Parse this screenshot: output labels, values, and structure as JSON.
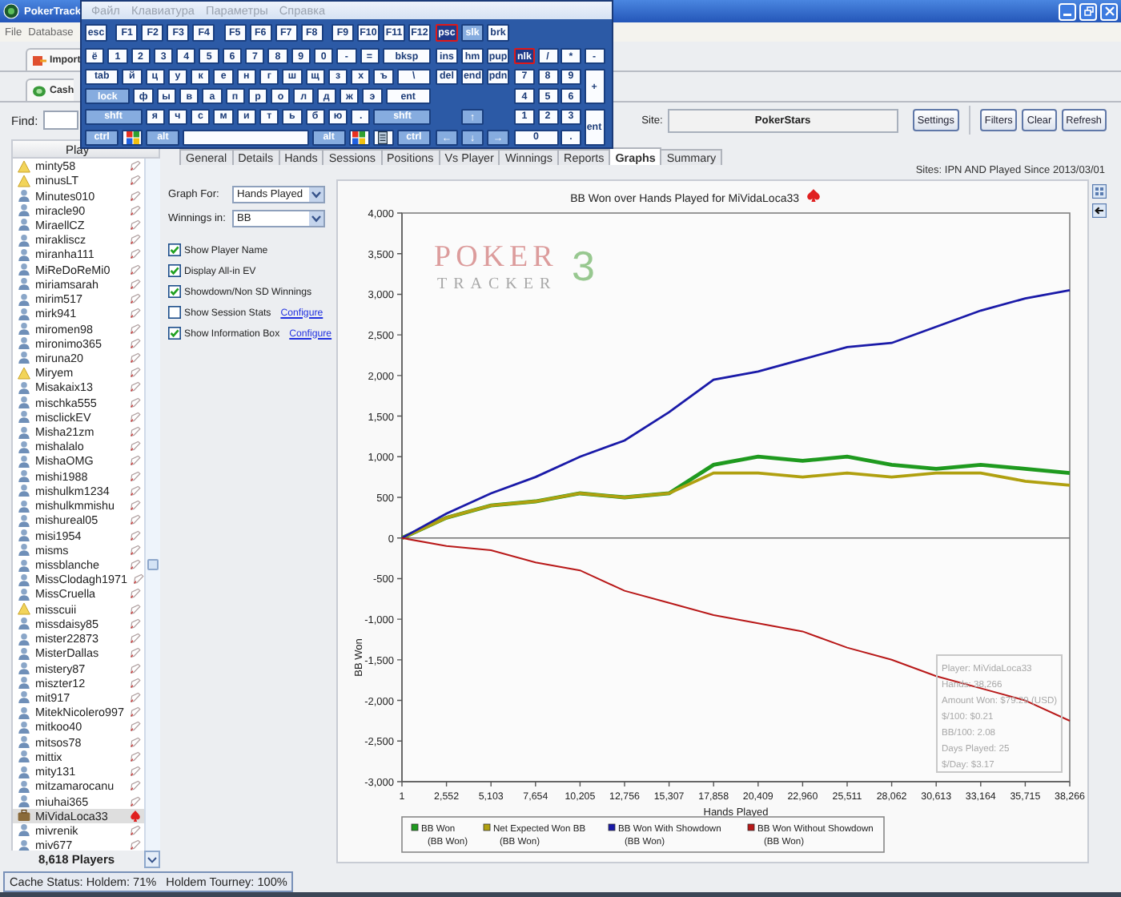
{
  "main_window": {
    "title": "PokerTrack",
    "menu": [
      "File",
      "Database"
    ],
    "toolbar_tab": "Import",
    "section_tab": "Cash",
    "find": {
      "label": "Find:"
    },
    "site": {
      "label": "Site:",
      "value": "PokerStars"
    },
    "buttons": [
      "Settings",
      "Filters",
      "Clear",
      "Refresh"
    ]
  },
  "players": {
    "header": "Play",
    "rows": [
      {
        "name": "minty58",
        "kind": "warning",
        "selected": false
      },
      {
        "name": "minusLT",
        "kind": "warning",
        "selected": false
      },
      {
        "name": "Minutes010",
        "kind": "person",
        "selected": false
      },
      {
        "name": "miracle90",
        "kind": "person",
        "selected": false
      },
      {
        "name": "MiraellCZ",
        "kind": "person",
        "selected": false
      },
      {
        "name": "mirakliscz",
        "kind": "person",
        "selected": false
      },
      {
        "name": "miranha111",
        "kind": "person",
        "selected": false
      },
      {
        "name": "MiReDoReMi0",
        "kind": "person",
        "selected": false
      },
      {
        "name": "miriamsarah",
        "kind": "person",
        "selected": false
      },
      {
        "name": "mirim517",
        "kind": "person",
        "selected": false
      },
      {
        "name": "mirk941",
        "kind": "person",
        "selected": false
      },
      {
        "name": "miromen98",
        "kind": "person",
        "selected": false
      },
      {
        "name": "mironimo365",
        "kind": "person",
        "selected": false
      },
      {
        "name": "miruna20",
        "kind": "person",
        "selected": false
      },
      {
        "name": "Miryem",
        "kind": "warning",
        "selected": false
      },
      {
        "name": "Misakaix13",
        "kind": "person",
        "selected": false
      },
      {
        "name": "mischka555",
        "kind": "person",
        "selected": false
      },
      {
        "name": "misclickEV",
        "kind": "person",
        "selected": false
      },
      {
        "name": "Misha21zm",
        "kind": "person",
        "selected": false
      },
      {
        "name": "mishalalo",
        "kind": "person",
        "selected": false
      },
      {
        "name": "MishaOMG",
        "kind": "person",
        "selected": false
      },
      {
        "name": "mishi1988",
        "kind": "person",
        "selected": false
      },
      {
        "name": "mishulkm1234",
        "kind": "person",
        "selected": false
      },
      {
        "name": "mishulkmmishu",
        "kind": "person",
        "selected": false
      },
      {
        "name": "mishureal05",
        "kind": "person",
        "selected": false
      },
      {
        "name": "misi1954",
        "kind": "person",
        "selected": false
      },
      {
        "name": "misms",
        "kind": "person",
        "selected": false
      },
      {
        "name": "missblanche",
        "kind": "person",
        "selected": false
      },
      {
        "name": "MissClodagh1971",
        "kind": "person",
        "selected": false
      },
      {
        "name": "MissCruella",
        "kind": "person",
        "selected": false
      },
      {
        "name": "misscuii",
        "kind": "warning",
        "selected": false
      },
      {
        "name": "missdaisy85",
        "kind": "person",
        "selected": false
      },
      {
        "name": "mister22873",
        "kind": "person",
        "selected": false
      },
      {
        "name": "MisterDallas",
        "kind": "person",
        "selected": false
      },
      {
        "name": "mistery87",
        "kind": "person",
        "selected": false
      },
      {
        "name": "miszter12",
        "kind": "person",
        "selected": false
      },
      {
        "name": "mit917",
        "kind": "person",
        "selected": false
      },
      {
        "name": "MitekNicolero997",
        "kind": "person",
        "selected": false
      },
      {
        "name": "mitkoo40",
        "kind": "person",
        "selected": false
      },
      {
        "name": "mitsos78",
        "kind": "person",
        "selected": false
      },
      {
        "name": "mittix",
        "kind": "person",
        "selected": false
      },
      {
        "name": "mity131",
        "kind": "person",
        "selected": false
      },
      {
        "name": "mitzamarocanu",
        "kind": "person",
        "selected": false
      },
      {
        "name": "miuhai365",
        "kind": "person",
        "selected": false
      },
      {
        "name": "MiVidaLoca33",
        "kind": "briefcase",
        "selected": true
      },
      {
        "name": "mivrenik",
        "kind": "person",
        "selected": false
      },
      {
        "name": "miv677",
        "kind": "person",
        "selected": false
      }
    ],
    "count": "8,618 Players"
  },
  "report_tabs": [
    {
      "label": "General",
      "selected": false
    },
    {
      "label": "Details",
      "selected": false
    },
    {
      "label": "Hands",
      "selected": false
    },
    {
      "label": "Sessions",
      "selected": false
    },
    {
      "label": "Positions",
      "selected": false
    },
    {
      "label": "Vs Player",
      "selected": false
    },
    {
      "label": "Winnings",
      "selected": false
    },
    {
      "label": "Reports",
      "selected": false
    },
    {
      "label": "Graphs",
      "selected": true
    },
    {
      "label": "Summary",
      "selected": false
    }
  ],
  "filter_summary": "Sites: IPN AND Played Since 2013/03/01",
  "graph_options": {
    "graph_for": {
      "label": "Graph For:",
      "value": "Hands Played"
    },
    "winnings_in": {
      "label": "Winnings in:",
      "value": "BB"
    },
    "checkboxes": [
      {
        "label": "Show Player Name",
        "checked": true
      },
      {
        "label": "Display All-in EV",
        "checked": true
      },
      {
        "label": "Showdown/Non SD Winnings",
        "checked": true
      },
      {
        "label": "Show Session Stats",
        "checked": false,
        "link": "Configure"
      },
      {
        "label": "Show Information Box",
        "checked": true,
        "link": "Configure"
      }
    ]
  },
  "chart": {
    "watermark": {
      "word": "POKER",
      "subword": "TRACKER",
      "mark": "3"
    },
    "chart_data": {
      "type": "line",
      "title": "BB Won over Hands Played for MiVidaLoca33",
      "xlabel": "Hands Played",
      "ylabel": "BB Won",
      "x": [
        1,
        2552,
        5103,
        7654,
        10205,
        12756,
        15307,
        17858,
        20409,
        22960,
        25511,
        28062,
        30613,
        33164,
        35715,
        38266
      ],
      "series": [
        {
          "name": "BB Won",
          "color": "#1f9a1f",
          "values": [
            0,
            250,
            400,
            450,
            550,
            500,
            550,
            900,
            1000,
            950,
            1000,
            900,
            850,
            900,
            850,
            800
          ]
        },
        {
          "name": "Net Expected Won BB",
          "color": "#b0a010",
          "values": [
            0,
            250,
            400,
            450,
            550,
            500,
            550,
            800,
            800,
            750,
            800,
            750,
            800,
            800,
            700,
            650
          ]
        },
        {
          "name": "BB Won With Showdown",
          "color": "#1a1aa8",
          "values": [
            0,
            300,
            550,
            750,
            1000,
            1200,
            1550,
            1950,
            2050,
            2200,
            2350,
            2400,
            2600,
            2800,
            2950,
            3050
          ]
        },
        {
          "name": "BB Won Without Showdown",
          "color": "#b81818",
          "values": [
            0,
            -100,
            -150,
            -300,
            -400,
            -650,
            -800,
            -950,
            -1050,
            -1150,
            -1350,
            -1500,
            -1700,
            -1850,
            -2000,
            -2250
          ]
        }
      ],
      "legend": true,
      "xlim": [
        1,
        38266
      ],
      "ylim": [
        -3000,
        4000
      ],
      "xticks": [
        {
          "value": 1,
          "label": "1"
        },
        {
          "value": 2552,
          "label": "2,552"
        },
        {
          "value": 5103,
          "label": "5,103"
        },
        {
          "value": 7654,
          "label": "7,654"
        },
        {
          "value": 10205,
          "label": "10,205"
        },
        {
          "value": 12756,
          "label": "12,756"
        },
        {
          "value": 15307,
          "label": "15,307"
        },
        {
          "value": 17858,
          "label": "17,858"
        },
        {
          "value": 20409,
          "label": "20,409"
        },
        {
          "value": 22960,
          "label": "22,960"
        },
        {
          "value": 25511,
          "label": "25,511"
        },
        {
          "value": 28062,
          "label": "28,062"
        },
        {
          "value": 30613,
          "label": "30,613"
        },
        {
          "value": 33164,
          "label": "33,164"
        },
        {
          "value": 35715,
          "label": "35,715"
        },
        {
          "value": 38266,
          "label": "38,266"
        }
      ],
      "yticks": [
        {
          "value": 4000,
          "label": "4,000"
        },
        {
          "value": 3500,
          "label": "3,500"
        },
        {
          "value": 3000,
          "label": "3,000"
        },
        {
          "value": 2500,
          "label": "2,500"
        },
        {
          "value": 2000,
          "label": "2,000"
        },
        {
          "value": 1500,
          "label": "1,500"
        },
        {
          "value": 1000,
          "label": "1,000"
        },
        {
          "value": 500,
          "label": "500"
        },
        {
          "value": 0,
          "label": "0"
        },
        {
          "value": -500,
          "label": "-500"
        },
        {
          "value": -1000,
          "label": "-1,000"
        },
        {
          "value": -1500,
          "label": "-1,500"
        },
        {
          "value": -2000,
          "label": "-2,000"
        },
        {
          "value": -2500,
          "label": "-2,500"
        },
        {
          "value": -3000,
          "label": "-3,000"
        }
      ]
    },
    "legend_notes": [
      "(BB Won)",
      "(BB Won)",
      "(BB Won)",
      "(BB Won)"
    ],
    "info_box": [
      "Player: MiVidaLoca33",
      "Hands: 38,266",
      "Amount Won: $79.29 (USD)",
      "$/100: $0.21",
      "BB/100: 2.08",
      "Days Played: 25",
      "$/Day: $3.17"
    ]
  },
  "status_bar": [
    "Cache Status: Holdem: 71%",
    "Holdem Tourney: 100%"
  ],
  "keyboard": {
    "menu": [
      "Файл",
      "Клавиатура",
      "Параметры",
      "Справка"
    ],
    "function_groups": [
      [
        "esc"
      ],
      [
        "F1",
        "F2",
        "F3",
        "F4"
      ],
      [
        "F5",
        "F6",
        "F7",
        "F8"
      ],
      [
        "F9",
        "F10",
        "F11",
        "F12"
      ]
    ],
    "main_rows": [
      [
        {
          "label": "ё",
          "kind": "key"
        },
        {
          "label": "1",
          "kind": "key"
        },
        {
          "label": "2",
          "kind": "key"
        },
        {
          "label": "3",
          "kind": "key"
        },
        {
          "label": "4",
          "kind": "key"
        },
        {
          "label": "5",
          "kind": "key"
        },
        {
          "label": "6",
          "kind": "key"
        },
        {
          "label": "7",
          "kind": "key"
        },
        {
          "label": "8",
          "kind": "key"
        },
        {
          "label": "9",
          "kind": "key"
        },
        {
          "label": "0",
          "kind": "key"
        },
        {
          "label": "-",
          "kind": "key"
        },
        {
          "label": "=",
          "kind": "key"
        },
        {
          "label": "bksp",
          "kind": "wide"
        }
      ],
      [
        {
          "label": "tab",
          "kind": "wide"
        },
        {
          "label": "й",
          "kind": "key"
        },
        {
          "label": "ц",
          "kind": "key"
        },
        {
          "label": "у",
          "kind": "key"
        },
        {
          "label": "к",
          "kind": "key"
        },
        {
          "label": "е",
          "kind": "key"
        },
        {
          "label": "н",
          "kind": "key"
        },
        {
          "label": "г",
          "kind": "key"
        },
        {
          "label": "ш",
          "kind": "key"
        },
        {
          "label": "щ",
          "kind": "key"
        },
        {
          "label": "з",
          "kind": "key"
        },
        {
          "label": "х",
          "kind": "key"
        },
        {
          "label": "ъ",
          "kind": "key"
        },
        {
          "label": "\\",
          "kind": "wide"
        }
      ],
      [
        {
          "label": "lock",
          "kind": "modwide"
        },
        {
          "label": "ф",
          "kind": "key"
        },
        {
          "label": "ы",
          "kind": "key"
        },
        {
          "label": "в",
          "kind": "key"
        },
        {
          "label": "а",
          "kind": "key"
        },
        {
          "label": "п",
          "kind": "key"
        },
        {
          "label": "р",
          "kind": "key"
        },
        {
          "label": "о",
          "kind": "key"
        },
        {
          "label": "л",
          "kind": "key"
        },
        {
          "label": "д",
          "kind": "key"
        },
        {
          "label": "ж",
          "kind": "key"
        },
        {
          "label": "э",
          "kind": "key"
        },
        {
          "label": "ent",
          "kind": "wide"
        }
      ],
      [
        {
          "label": "shft",
          "kind": "modwide"
        },
        {
          "label": "я",
          "kind": "key"
        },
        {
          "label": "ч",
          "kind": "key"
        },
        {
          "label": "с",
          "kind": "key"
        },
        {
          "label": "м",
          "kind": "key"
        },
        {
          "label": "и",
          "kind": "key"
        },
        {
          "label": "т",
          "kind": "key"
        },
        {
          "label": "ь",
          "kind": "key"
        },
        {
          "label": "б",
          "kind": "key"
        },
        {
          "label": "ю",
          "kind": "key"
        },
        {
          "label": ".",
          "kind": "key"
        },
        {
          "label": "shft",
          "kind": "modwide"
        }
      ],
      [
        {
          "label": "ctrl",
          "kind": "modwide"
        },
        {
          "kind": "win"
        },
        {
          "label": "alt",
          "kind": "modwide"
        },
        {
          "kind": "space"
        },
        {
          "label": "alt",
          "kind": "modwide"
        },
        {
          "kind": "win"
        },
        {
          "kind": "menu"
        },
        {
          "label": "ctrl",
          "kind": "modwide"
        }
      ]
    ],
    "nav_top": [
      [
        {
          "label": "psc",
          "kind": "key",
          "on": true
        },
        {
          "label": "slk",
          "kind": "mod",
          "on": false
        },
        {
          "label": "brk",
          "kind": "key",
          "on": false
        }
      ],
      [
        {
          "label": "ins",
          "kind": "key",
          "on": false
        },
        {
          "label": "hm",
          "kind": "key",
          "on": false
        },
        {
          "label": "pup",
          "kind": "key",
          "on": false
        }
      ],
      [
        {
          "label": "del",
          "kind": "key",
          "on": false
        },
        {
          "label": "end",
          "kind": "key",
          "on": false
        },
        {
          "label": "pdn",
          "kind": "key",
          "on": false
        }
      ]
    ],
    "arrows": [
      [
        "↑"
      ],
      [
        "←",
        "↓",
        "→"
      ]
    ],
    "numpad": [
      {
        "label": "nlk",
        "kind": "key",
        "on": true
      },
      {
        "label": "/",
        "kind": "key",
        "on": false
      },
      {
        "label": "*",
        "kind": "key",
        "on": false
      },
      {
        "label": "-",
        "kind": "key",
        "on": false
      },
      {
        "label": "7",
        "kind": "key",
        "on": false
      },
      {
        "label": "8",
        "kind": "key",
        "on": false
      },
      {
        "label": "9",
        "kind": "key",
        "on": false
      },
      {
        "label": "+",
        "kind": "tall",
        "on": false
      },
      {
        "label": "4",
        "kind": "key",
        "on": false
      },
      {
        "label": "5",
        "kind": "key",
        "on": false
      },
      {
        "label": "6",
        "kind": "key",
        "on": false
      },
      {
        "label": "1",
        "kind": "key",
        "on": false
      },
      {
        "label": "2",
        "kind": "key",
        "on": false
      },
      {
        "label": "3",
        "kind": "key",
        "on": false
      },
      {
        "label": "ent",
        "kind": "tall",
        "on": false
      },
      {
        "label": "0",
        "kind": "wide",
        "on": false
      },
      {
        "label": ".",
        "kind": "key",
        "on": false
      }
    ]
  }
}
